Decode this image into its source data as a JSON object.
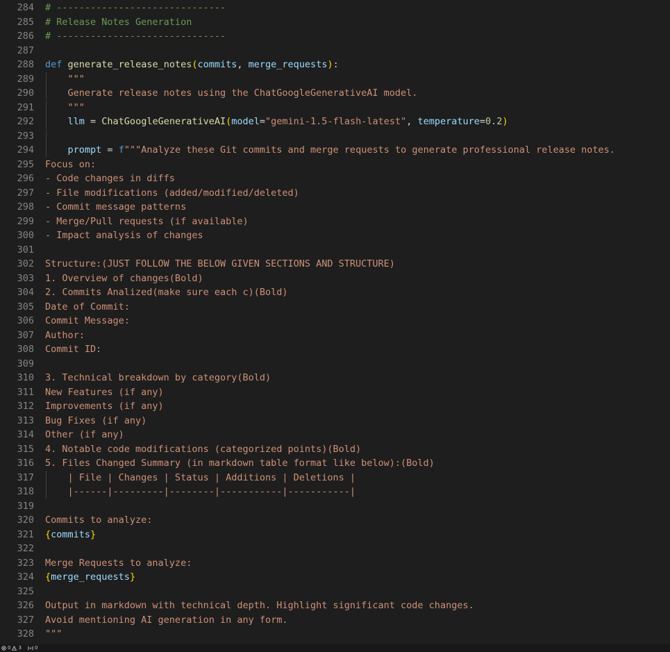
{
  "editor": {
    "lines": [
      {
        "n": "284",
        "tokens": [
          {
            "t": "# ------------------------------",
            "c": "comment"
          }
        ]
      },
      {
        "n": "285",
        "tokens": [
          {
            "t": "# Release Notes Generation",
            "c": "comment"
          }
        ]
      },
      {
        "n": "286",
        "tokens": [
          {
            "t": "# ------------------------------",
            "c": "comment"
          }
        ]
      },
      {
        "n": "287",
        "tokens": []
      },
      {
        "n": "288",
        "tokens": [
          {
            "t": "def",
            "c": "keyword"
          },
          {
            "t": " ",
            "c": "op"
          },
          {
            "t": "generate_release_notes",
            "c": "func"
          },
          {
            "t": "(",
            "c": "brace"
          },
          {
            "t": "commits",
            "c": "param"
          },
          {
            "t": ", ",
            "c": "op"
          },
          {
            "t": "merge_requests",
            "c": "param"
          },
          {
            "t": ")",
            "c": "brace"
          },
          {
            "t": ":",
            "c": "op"
          }
        ]
      },
      {
        "n": "289",
        "guide": true,
        "tokens": [
          {
            "t": "    \"\"\"",
            "c": "string"
          }
        ]
      },
      {
        "n": "290",
        "guide": true,
        "tokens": [
          {
            "t": "    Generate release notes using the ChatGoogleGenerativeAI model.",
            "c": "string"
          }
        ]
      },
      {
        "n": "291",
        "guide": true,
        "tokens": [
          {
            "t": "    \"\"\"",
            "c": "string"
          }
        ]
      },
      {
        "n": "292",
        "guide": true,
        "tokens": [
          {
            "t": "    ",
            "c": "op"
          },
          {
            "t": "llm",
            "c": "param"
          },
          {
            "t": " = ",
            "c": "op"
          },
          {
            "t": "ChatGoogleGenerativeAI",
            "c": "func"
          },
          {
            "t": "(",
            "c": "brace"
          },
          {
            "t": "model",
            "c": "param"
          },
          {
            "t": "=",
            "c": "op"
          },
          {
            "t": "\"gemini-1.5-flash-latest\"",
            "c": "string"
          },
          {
            "t": ", ",
            "c": "op"
          },
          {
            "t": "temperature",
            "c": "param"
          },
          {
            "t": "=",
            "c": "op"
          },
          {
            "t": "0.2",
            "c": "number"
          },
          {
            "t": ")",
            "c": "brace"
          }
        ]
      },
      {
        "n": "293",
        "guide": true,
        "tokens": []
      },
      {
        "n": "294",
        "guide": true,
        "tokens": [
          {
            "t": "    ",
            "c": "op"
          },
          {
            "t": "prompt",
            "c": "param"
          },
          {
            "t": " = ",
            "c": "op"
          },
          {
            "t": "f",
            "c": "fprefix"
          },
          {
            "t": "\"\"\"Analyze these Git commits and merge requests to generate professional release notes.",
            "c": "string"
          }
        ]
      },
      {
        "n": "295",
        "tokens": [
          {
            "t": "Focus on:",
            "c": "string"
          }
        ]
      },
      {
        "n": "296",
        "tokens": [
          {
            "t": "- Code changes in diffs",
            "c": "string"
          }
        ]
      },
      {
        "n": "297",
        "tokens": [
          {
            "t": "- File modifications (added/modified/deleted)",
            "c": "string"
          }
        ]
      },
      {
        "n": "298",
        "tokens": [
          {
            "t": "- Commit message patterns",
            "c": "string"
          }
        ]
      },
      {
        "n": "299",
        "tokens": [
          {
            "t": "- Merge/Pull requests (if available)",
            "c": "string"
          }
        ]
      },
      {
        "n": "300",
        "tokens": [
          {
            "t": "- Impact analysis of changes",
            "c": "string"
          }
        ]
      },
      {
        "n": "301",
        "tokens": []
      },
      {
        "n": "302",
        "tokens": [
          {
            "t": "Structure:(JUST FOLLOW THE BELOW GIVEN SECTIONS AND STRUCTURE)",
            "c": "string"
          }
        ]
      },
      {
        "n": "303",
        "tokens": [
          {
            "t": "1. Overview of changes(Bold)",
            "c": "string"
          }
        ]
      },
      {
        "n": "304",
        "tokens": [
          {
            "t": "2. Commits Analized(make sure each c)(Bold)",
            "c": "string"
          }
        ]
      },
      {
        "n": "305",
        "tokens": [
          {
            "t": "Date of Commit:",
            "c": "string"
          }
        ]
      },
      {
        "n": "306",
        "tokens": [
          {
            "t": "Commit Message:",
            "c": "string"
          }
        ]
      },
      {
        "n": "307",
        "tokens": [
          {
            "t": "Author:",
            "c": "string"
          }
        ]
      },
      {
        "n": "308",
        "tokens": [
          {
            "t": "Commit ID:",
            "c": "string"
          }
        ]
      },
      {
        "n": "309",
        "tokens": []
      },
      {
        "n": "310",
        "tokens": [
          {
            "t": "3. Technical breakdown by category(Bold)",
            "c": "string"
          }
        ]
      },
      {
        "n": "311",
        "tokens": [
          {
            "t": "New Features (if any)",
            "c": "string"
          }
        ]
      },
      {
        "n": "312",
        "tokens": [
          {
            "t": "Improvements (if any)",
            "c": "string"
          }
        ]
      },
      {
        "n": "313",
        "tokens": [
          {
            "t": "Bug Fixes (if any)",
            "c": "string"
          }
        ]
      },
      {
        "n": "314",
        "tokens": [
          {
            "t": "Other (if any)",
            "c": "string"
          }
        ]
      },
      {
        "n": "315",
        "tokens": [
          {
            "t": "4. Notable code modifications (categorized points)(Bold)",
            "c": "string"
          }
        ]
      },
      {
        "n": "316",
        "tokens": [
          {
            "t": "5. Files Changed Summary (in markdown table format like below):(Bold)",
            "c": "string"
          }
        ]
      },
      {
        "n": "317",
        "guide": true,
        "tokens": [
          {
            "t": "    | File | Changes | Status | Additions | Deletions |",
            "c": "string"
          }
        ]
      },
      {
        "n": "318",
        "guide": true,
        "tokens": [
          {
            "t": "    |------|---------|--------|-----------|-----------|",
            "c": "string"
          }
        ]
      },
      {
        "n": "319",
        "tokens": []
      },
      {
        "n": "320",
        "tokens": [
          {
            "t": "Commits to analyze:",
            "c": "string"
          }
        ]
      },
      {
        "n": "321",
        "tokens": [
          {
            "t": "{",
            "c": "brace"
          },
          {
            "t": "commits",
            "c": "param"
          },
          {
            "t": "}",
            "c": "brace"
          }
        ]
      },
      {
        "n": "322",
        "tokens": []
      },
      {
        "n": "323",
        "tokens": [
          {
            "t": "Merge Requests to analyze:",
            "c": "string"
          }
        ]
      },
      {
        "n": "324",
        "tokens": [
          {
            "t": "{",
            "c": "brace"
          },
          {
            "t": "merge_requests",
            "c": "param"
          },
          {
            "t": "}",
            "c": "brace"
          }
        ]
      },
      {
        "n": "325",
        "tokens": []
      },
      {
        "n": "326",
        "tokens": [
          {
            "t": "Output in markdown with technical depth. Highlight significant code changes.",
            "c": "string"
          }
        ]
      },
      {
        "n": "327",
        "tokens": [
          {
            "t": "Avoid mentioning AI generation in any form.",
            "c": "string"
          }
        ]
      },
      {
        "n": "328",
        "tokens": [
          {
            "t": "\"\"\"",
            "c": "string"
          }
        ]
      }
    ]
  },
  "statusbar": {
    "errors_icon": "error-circle-icon",
    "errors": "0",
    "warnings_icon": "warning-triangle-icon",
    "warnings": "3",
    "ports_icon": "ports-antenna-icon",
    "ports": "0"
  },
  "colors": {
    "background": "#1e1e1e",
    "line_number": "#858585",
    "comment": "#6a9955",
    "keyword": "#569cd6",
    "function": "#dcdcaa",
    "parameter": "#9cdcfe",
    "string": "#ce9178",
    "number": "#b5cea8",
    "brace": "#ffd700"
  }
}
